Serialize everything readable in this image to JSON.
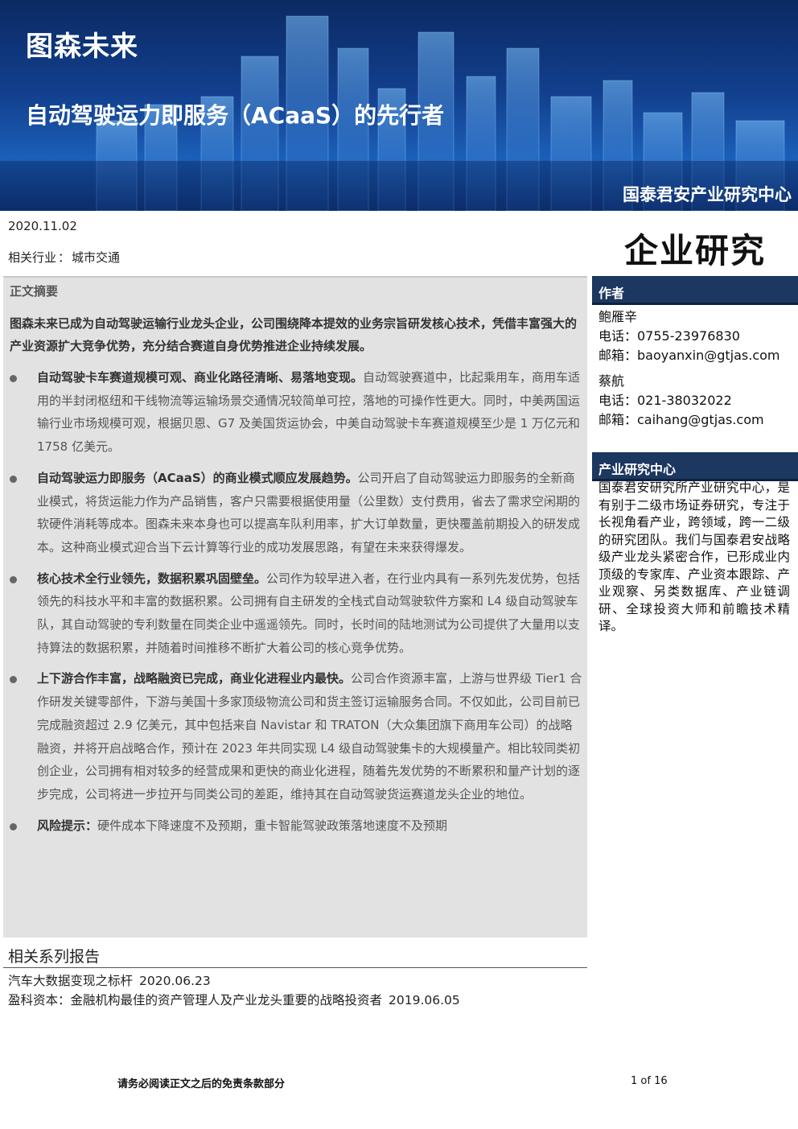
{
  "banner": {
    "brand": "图森未来",
    "headline": "自动驾驶运力即服务（ACaaS）的先行者",
    "org": "国泰君安产业研究中心"
  },
  "meta": {
    "date": "2020.11.02",
    "industry_label": "相关行业",
    "industry_value": "城市交通",
    "doc_type": "企业研究"
  },
  "summary": {
    "title": "正文摘要",
    "intro": "图森未来已成为自动驾驶运输行业龙头企业，公司围绕降本提效的业务宗旨研发核心技术，凭借丰富强大的产业资源扩大竞争优势，充分结合赛道自身优势推进企业持续发展。",
    "bullets": [
      {
        "lead": "自动驾驶卡车赛道规模可观、商业化路径清晰、易落地变现。",
        "text": "自动驾驶赛道中，比起乘用车，商用车适用的半封闭枢纽和干线物流等运输场景交通情况较简单可控，落地的可操作性更大。同时，中美两国运输行业市场规模可观，根据贝恩、G7 及美国货运协会，中美自动驾驶卡车赛道规模至少是 1 万亿元和 1758 亿美元。"
      },
      {
        "lead": "自动驾驶运力即服务（ACaaS）的商业模式顺应发展趋势。",
        "text": "公司开启了自动驾驶运力即服务的全新商业模式，将货运能力作为产品销售，客户只需要根据使用量（公里数）支付费用，省去了需求空闲期的软硬件消耗等成本。图森未来本身也可以提高车队利用率，扩大订单数量，更快覆盖前期投入的研发成本。这种商业模式迎合当下云计算等行业的成功发展思路，有望在未来获得爆发。"
      },
      {
        "lead": "核心技术全行业领先，数据积累巩固壁垒。",
        "text": "公司作为较早进入者，在行业内具有一系列先发优势，包括领先的科技水平和丰富的数据积累。公司拥有自主研发的全栈式自动驾驶软件方案和 L4 级自动驾驶车队，其自动驾驶的专利数量在同类企业中遥遥领先。同时，长时间的陆地测试为公司提供了大量用以支持算法的数据积累，并随着时间推移不断扩大着公司的核心竞争优势。"
      },
      {
        "lead": "上下游合作丰富，战略融资已完成，商业化进程业内最快。",
        "text": "公司合作资源丰富，上游与世界级 Tier1 合作研发关键零部件，下游与美国十多家顶级物流公司和货主签订运输服务合同。不仅如此，公司目前已完成融资超过 2.9 亿美元，其中包括来自 Navistar 和 TRATON（大众集团旗下商用车公司）的战略融资，并将开启战略合作，预计在 2023 年共同实现 L4 级自动驾驶集卡的大规模量产。相比较同类初创企业，公司拥有相对较多的经营成果和更快的商业化进程，随着先发优势的不断累积和量产计划的逐步完成，公司将进一步拉开与同类公司的差距，维持其在自动驾驶货运赛道龙头企业的地位。"
      },
      {
        "lead": "风险提示：",
        "text": "硬件成本下降速度不及预期，重卡智能驾驶政策落地速度不及预期"
      }
    ]
  },
  "side": {
    "authors_title": "作者",
    "authors": [
      {
        "name": "鲍雁辛",
        "phone": "电话：0755-23976830",
        "email": "邮箱：baoyanxin@gtjas.com"
      },
      {
        "name": "蔡航",
        "phone": "电话：021-38032022",
        "email": "邮箱：caihang@gtjas.com"
      }
    ],
    "center_title": "产业研究中心",
    "center_desc": "国泰君安研究所产业研究中心，是有别于二级市场证券研究，专注于长视角看产业，跨领域，跨一二级的研究团队。我们与国泰君安战略级产业龙头紧密合作，已形成业内顶级的专家库、产业资本跟踪、产业观察、另类数据库、产业链调研、全球投资大师和前瞻技术精译。"
  },
  "related": {
    "title": "相关系列报告",
    "items": [
      {
        "name": "汽车大数据变现之标杆",
        "date": "2020.06.23"
      },
      {
        "name": "盈科资本：金融机构最佳的资产管理人及产业龙头重要的战略投资者",
        "date": "2019.06.05"
      }
    ]
  },
  "footer": {
    "note": "请务必阅读正文之后的免责条款部分",
    "page": "1 of 16"
  }
}
